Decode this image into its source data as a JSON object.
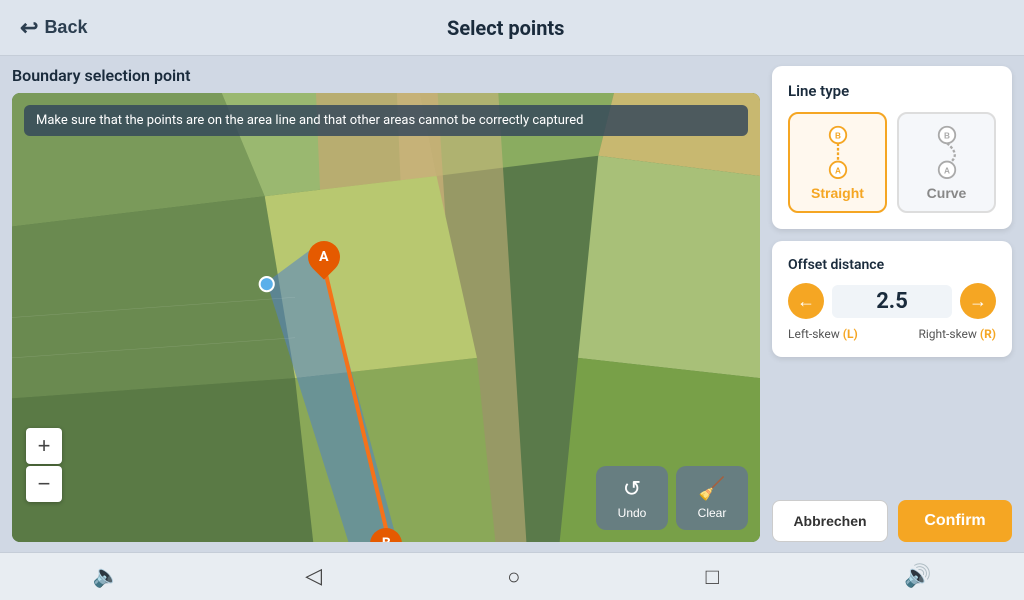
{
  "topbar": {
    "back_label": "Back",
    "title": "Select points"
  },
  "map": {
    "boundary_title": "Boundary selection point",
    "info_banner": "Make sure that the points are on the area line and that other areas cannot be correctly captured",
    "zoom_in": "+",
    "zoom_out": "−",
    "undo_label": "Undo",
    "clear_label": "Clear"
  },
  "line_type": {
    "label": "Line type",
    "straight_label": "Straight",
    "curve_label": "Curve"
  },
  "offset": {
    "label": "Offset distance",
    "value": "2.5",
    "left_skew": "Left-skew (L)",
    "right_skew": "Right-skew (R)"
  },
  "actions": {
    "abbrechen_label": "Abbrechen",
    "confirm_label": "Confirm"
  },
  "bottom_nav": {
    "icons": [
      "volume-down",
      "back",
      "home",
      "square",
      "volume-up"
    ]
  }
}
